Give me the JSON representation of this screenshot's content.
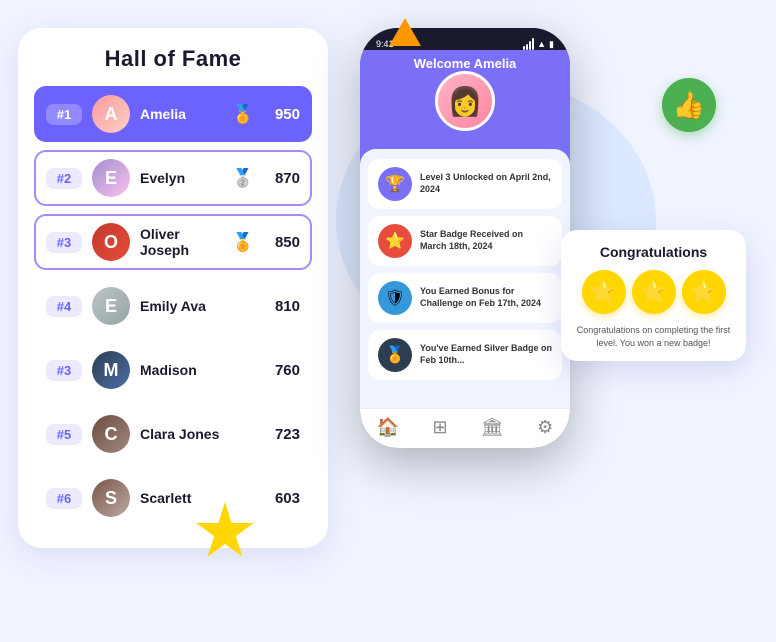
{
  "background": {
    "color": "#f0f4ff"
  },
  "decorative": {
    "triangle_color": "#ff9800",
    "star_color": "#ffd600",
    "thumbs_up_icon": "👍",
    "thumbs_up_color": "#4caf50"
  },
  "hall_of_fame": {
    "title": "Hall of Fame",
    "entries": [
      {
        "rank": "#1",
        "name": "Amelia",
        "score": "950",
        "medal": "🏅",
        "avatar_letter": "A",
        "av_class": "av-amelia",
        "style": "rank1"
      },
      {
        "rank": "#2",
        "name": "Evelyn",
        "score": "870",
        "medal": "🥈",
        "avatar_letter": "E",
        "av_class": "av-evelyn",
        "style": "rank2"
      },
      {
        "rank": "#3",
        "name": "Oliver Joseph",
        "score": "850",
        "medal": "🏅",
        "avatar_letter": "O",
        "av_class": "av-oliver",
        "style": "rank3"
      },
      {
        "rank": "#4",
        "name": "Emily Ava",
        "score": "810",
        "medal": "",
        "avatar_letter": "E",
        "av_class": "av-emily",
        "style": "rank4"
      },
      {
        "rank": "#3",
        "name": "Madison",
        "score": "760",
        "medal": "",
        "avatar_letter": "M",
        "av_class": "av-madison",
        "style": "rank4"
      },
      {
        "rank": "#5",
        "name": "Clara Jones",
        "score": "723",
        "medal": "",
        "avatar_letter": "C",
        "av_class": "av-clara",
        "style": "rank4"
      },
      {
        "rank": "#6",
        "name": "Scarlett",
        "score": "603",
        "medal": "",
        "avatar_letter": "S",
        "av_class": "av-scarlett",
        "style": "rank4"
      }
    ]
  },
  "phone": {
    "time": "9:41",
    "welcome_text": "Welcome Amelia",
    "activities": [
      {
        "icon": "🏆",
        "icon_class": "purple",
        "text": "Level 3 Unlocked on April 2nd, 2024"
      },
      {
        "icon": "⭐",
        "icon_class": "red",
        "text": "Star Badge Received on March 18th, 2024"
      },
      {
        "icon": "🛡",
        "icon_class": "blue",
        "text": "You Earned Bonus for Challenge on Feb 17th, 2024"
      },
      {
        "icon": "🏅",
        "icon_class": "dark",
        "text": "You've Earned Silver Badge on Feb 10th..."
      }
    ],
    "nav": [
      "🏠",
      "⊞",
      "🏛",
      "⚙"
    ]
  },
  "congrats_popup": {
    "title": "Congratulations",
    "stars": [
      "⭐",
      "⭐",
      "⭐"
    ],
    "message": "Congratulations on completing the first level. You won a new badge!"
  }
}
